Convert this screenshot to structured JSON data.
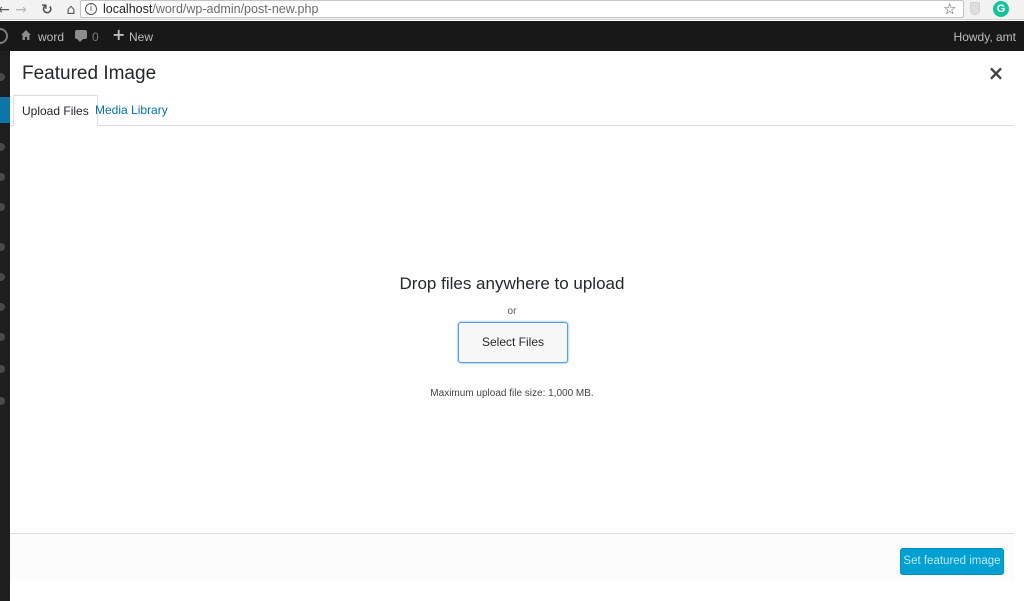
{
  "browser": {
    "url_host": "localhost",
    "url_path": "/word/wp-admin/post-new.php",
    "icons": [
      "back-arrow-icon",
      "forward-arrow-icon",
      "reload-icon",
      "home-icon",
      "info-icon",
      "star-icon",
      "shield-icon",
      "grammarly-icon"
    ],
    "grammarly_letter": "G"
  },
  "admin_bar": {
    "site_name": "word",
    "comment_count": "0",
    "new_label": "New",
    "howdy": "Howdy, amt"
  },
  "modal": {
    "title": "Featured Image",
    "close_symbol": "×",
    "tabs": [
      {
        "label": "Upload Files",
        "active": true
      },
      {
        "label": "Media Library",
        "active": false
      }
    ],
    "upload": {
      "drop_text": "Drop files anywhere to upload",
      "or_text": "or",
      "select_button": "Select Files",
      "max_size": "Maximum upload file size: 1,000 MB."
    },
    "footer": {
      "primary_button": "Set featured image"
    }
  },
  "colors": {
    "accent": "#0073aa",
    "primary_button": "#00a0d2",
    "admin_bar": "#181818"
  }
}
